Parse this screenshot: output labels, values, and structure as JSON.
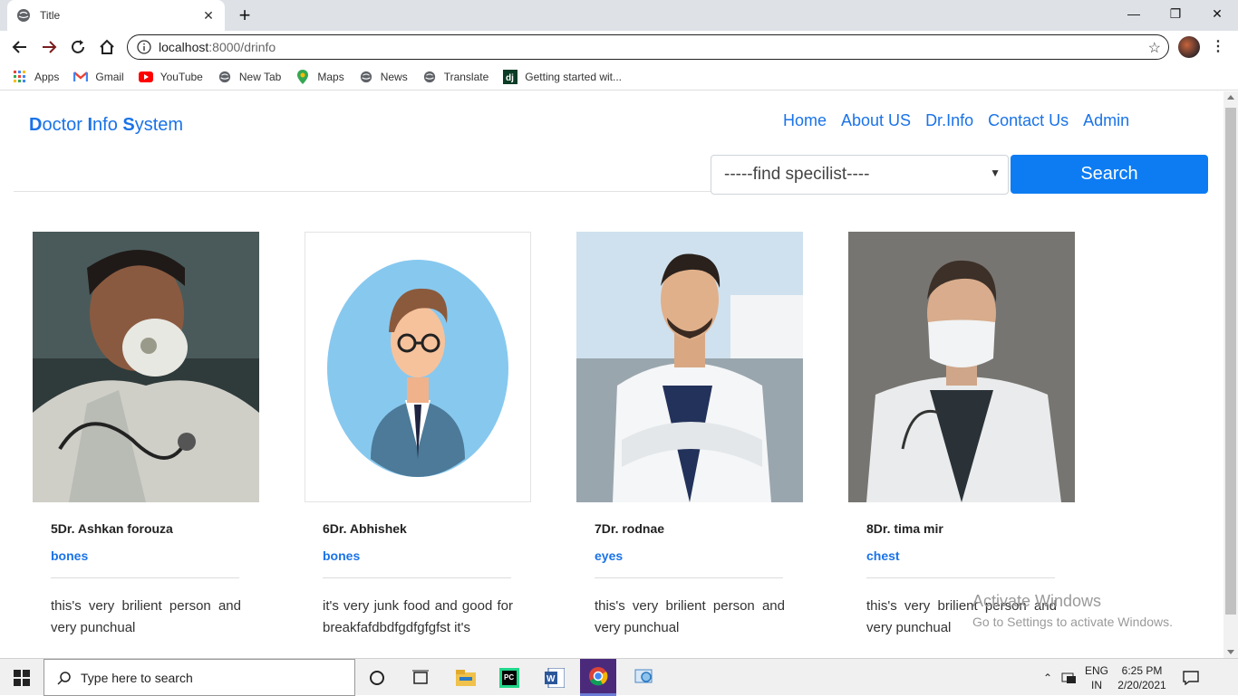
{
  "browser": {
    "tab_title": "Title",
    "new_tab_symbol": "+",
    "url_host": "localhost",
    "url_path": ":8000/drinfo",
    "bookmarks": [
      {
        "label": "Apps",
        "icon": "apps-grid-icon"
      },
      {
        "label": "Gmail",
        "icon": "gmail-icon"
      },
      {
        "label": "YouTube",
        "icon": "youtube-icon"
      },
      {
        "label": "New Tab",
        "icon": "globe-icon"
      },
      {
        "label": "Maps",
        "icon": "maps-pin-icon"
      },
      {
        "label": "News",
        "icon": "globe-icon"
      },
      {
        "label": "Translate",
        "icon": "globe-icon"
      },
      {
        "label": "Getting started wit...",
        "icon": "django-icon"
      }
    ]
  },
  "header": {
    "brand_D": "D",
    "brand_1": "octor ",
    "brand_I": "I",
    "brand_2": "nfo ",
    "brand_S": "S",
    "brand_3": "ystem",
    "nav": [
      "Home",
      "About US",
      "Dr.Info",
      "Contact Us",
      "Admin"
    ],
    "select_value": "-----find specilist----",
    "search_label": "Search"
  },
  "doctors": [
    {
      "name": "5Dr. Ashkan forouza",
      "specialty": "bones",
      "description": "this's very brilient person and very punchual"
    },
    {
      "name": "6Dr. Abhishek",
      "specialty": "bones",
      "description": "it's very junk food and good for breakfafdbdfgdfgfgfst it's"
    },
    {
      "name": "7Dr. rodnae",
      "specialty": "eyes",
      "description": "this's very brilient person and very punchual"
    },
    {
      "name": "8Dr. tima mir",
      "specialty": "chest",
      "description": "this's very brilient person and very punchual"
    }
  ],
  "watermark": {
    "line1": "Activate Windows",
    "line2": "Go to Settings to activate Windows."
  },
  "taskbar": {
    "search_placeholder": "Type here to search",
    "lang_1": "ENG",
    "lang_2": "IN",
    "time": "6:25 PM",
    "date": "2/20/2021"
  },
  "colors": {
    "accent": "#1a73e8",
    "search_button": "#0d7cf2"
  }
}
